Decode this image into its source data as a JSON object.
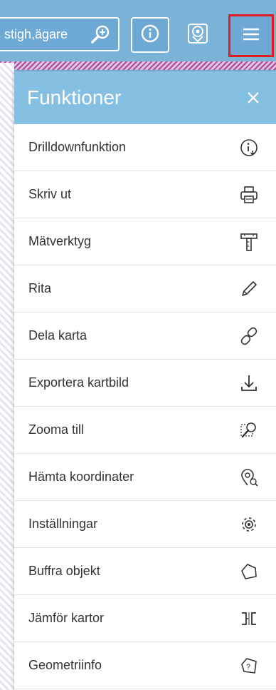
{
  "colors": {
    "accent": "#85c0e3",
    "toolbar_bg": "#6ea8d4",
    "highlight": "#e31b23"
  },
  "toolbar": {
    "search_text": "stigh,ägare",
    "search_icon": "search-plus-icon",
    "info_icon": "info-icon",
    "layers_icon": "layers-icon",
    "menu_icon": "hamburger-menu-icon"
  },
  "panel": {
    "title": "Funktioner",
    "close_icon": "close-icon",
    "items": [
      {
        "label": "Drilldownfunktion",
        "icon": "info-drilldown-icon"
      },
      {
        "label": "Skriv ut",
        "icon": "printer-icon"
      },
      {
        "label": "Mätverktyg",
        "icon": "ruler-icon"
      },
      {
        "label": "Rita",
        "icon": "pencil-icon"
      },
      {
        "label": "Dela karta",
        "icon": "link-icon"
      },
      {
        "label": "Exportera kartbild",
        "icon": "download-icon"
      },
      {
        "label": "Zooma till",
        "icon": "zoom-to-icon"
      },
      {
        "label": "Hämta koordinater",
        "icon": "location-search-icon"
      },
      {
        "label": "Inställningar",
        "icon": "gear-icon"
      },
      {
        "label": "Buffra objekt",
        "icon": "polygon-icon"
      },
      {
        "label": "Jämför kartor",
        "icon": "compare-icon"
      },
      {
        "label": "Geometriinfo",
        "icon": "geometry-info-icon"
      }
    ]
  }
}
